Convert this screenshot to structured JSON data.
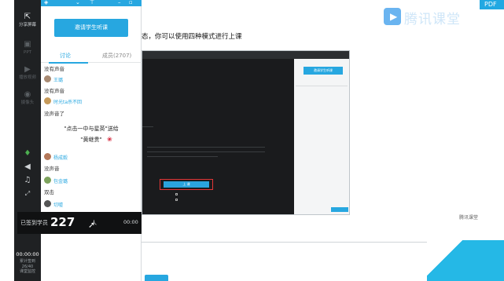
{
  "left_bar": {
    "items": [
      {
        "icon": "share-screen-icon",
        "label": "分享屏幕",
        "active": true
      },
      {
        "icon": "ppt-icon",
        "label": "PPT",
        "active": false
      },
      {
        "icon": "play-video-icon",
        "label": "播放视频",
        "active": false
      },
      {
        "icon": "camera-icon",
        "label": "摄像头",
        "active": false
      }
    ],
    "timer": "00:00:00",
    "footer_lines": [
      "累计签到",
      "26/40",
      "课堂监控"
    ]
  },
  "panel": {
    "invite_button": "邀请学生听课",
    "tabs": {
      "discuss": "讨论",
      "members": "成员(2707)"
    },
    "messages": [
      {
        "type": "text",
        "text": "没有声音"
      },
      {
        "type": "user",
        "name": "王璐"
      },
      {
        "type": "text",
        "text": "没有声音"
      },
      {
        "type": "user",
        "name": "时光ta杀不回"
      },
      {
        "type": "text",
        "text": "没声音了"
      },
      {
        "type": "notice",
        "text": "\"点击一中与星英\"送给"
      },
      {
        "type": "notice",
        "text": "\"黄继贵\""
      },
      {
        "type": "user",
        "name": "杨成毅"
      },
      {
        "type": "text",
        "text": "没声音"
      },
      {
        "type": "user",
        "name": "包金璐"
      },
      {
        "type": "text",
        "text": "双击"
      },
      {
        "type": "user",
        "name": "切嘘"
      }
    ],
    "signin": {
      "label": "已签到学员",
      "count": "227",
      "unit": "人",
      "time": "00:00"
    }
  },
  "main": {
    "title": "态，你可以使用四种模式进行上课",
    "logo_text": "腾讯课堂",
    "pdf_tag": "PDF",
    "mini_logo": "腾讯课堂",
    "embedded_invite": "邀请学生听课",
    "embedded_blue_button": "上 课"
  },
  "colors": {
    "accent": "#27a7e0",
    "dark": "#1f2123",
    "bottom_banner": "#25b8e6"
  }
}
